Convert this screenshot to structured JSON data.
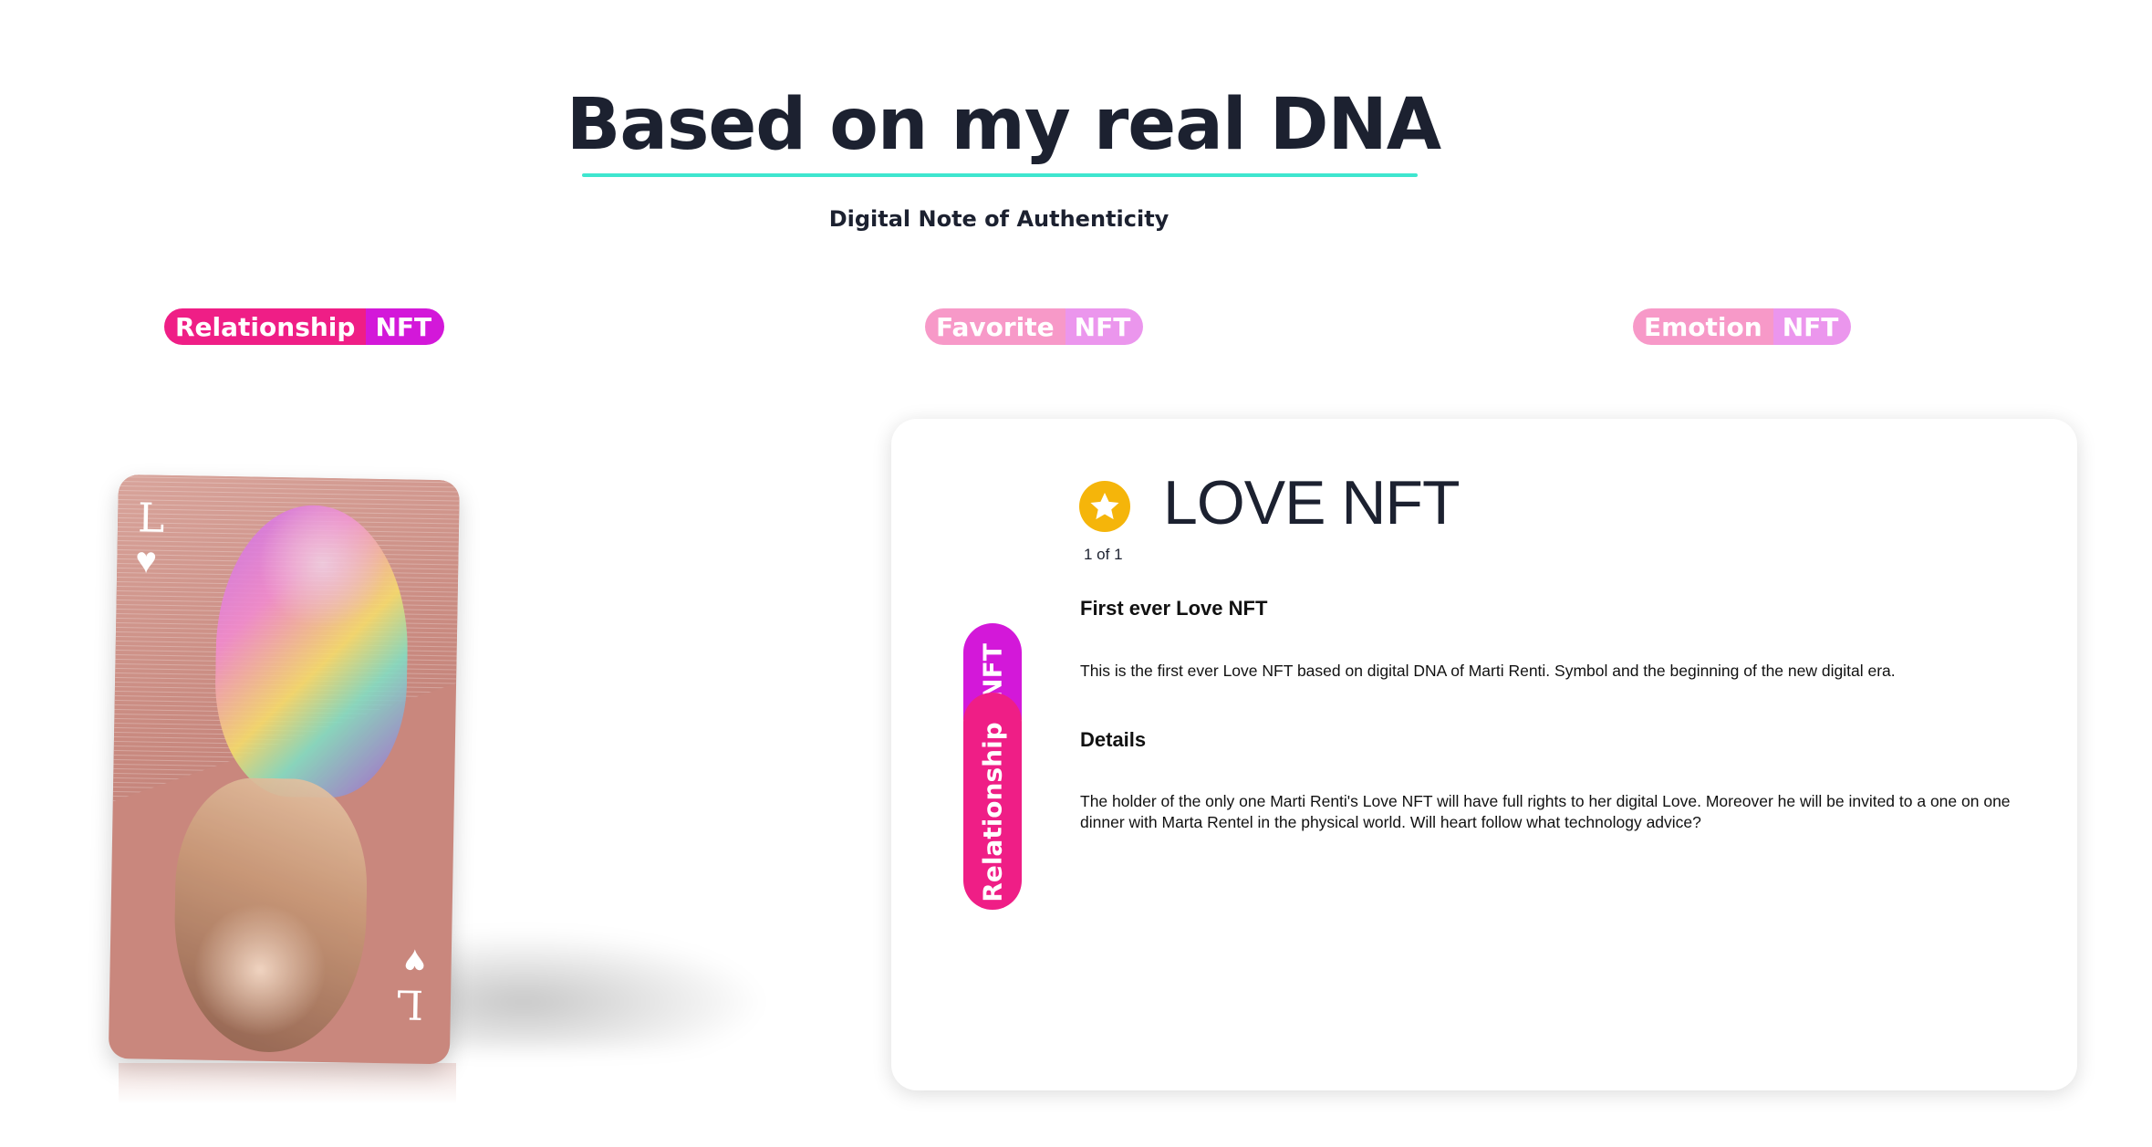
{
  "hero": {
    "title": "Based on my real DNA",
    "subtitle": "Digital Note of Authenticity"
  },
  "tabs": [
    {
      "word": "Relationship",
      "suffix": "NFT",
      "active": true
    },
    {
      "word": "Favorite",
      "suffix": "NFT",
      "active": false
    },
    {
      "word": "Emotion",
      "suffix": "NFT",
      "active": false
    }
  ],
  "card": {
    "corner_letter": "L",
    "suit_icon": "heart-icon"
  },
  "panel": {
    "badge": {
      "top": "NFT",
      "bottom": "Relationship"
    },
    "title": "LOVE NFT",
    "edition": "1 of 1",
    "heading_1": "First ever Love NFT",
    "text_1": "This is the first ever Love NFT based on digital DNA of Marti Renti. Symbol and the beginning of the new digital era.",
    "heading_2": "Details",
    "text_2": "The holder of the only one Marti Renti's Love NFT will have full rights to her digital Love. Moreover he will be invited to a one on one dinner with Marta Rentel in the physical world. Will heart follow what technology advice?"
  },
  "colors": {
    "accent_pink": "#ef1e86",
    "accent_magenta": "#d318d9",
    "underline_teal": "#3fe6cf",
    "star_gold": "#f5b50a",
    "text_dark": "#1c2130"
  }
}
